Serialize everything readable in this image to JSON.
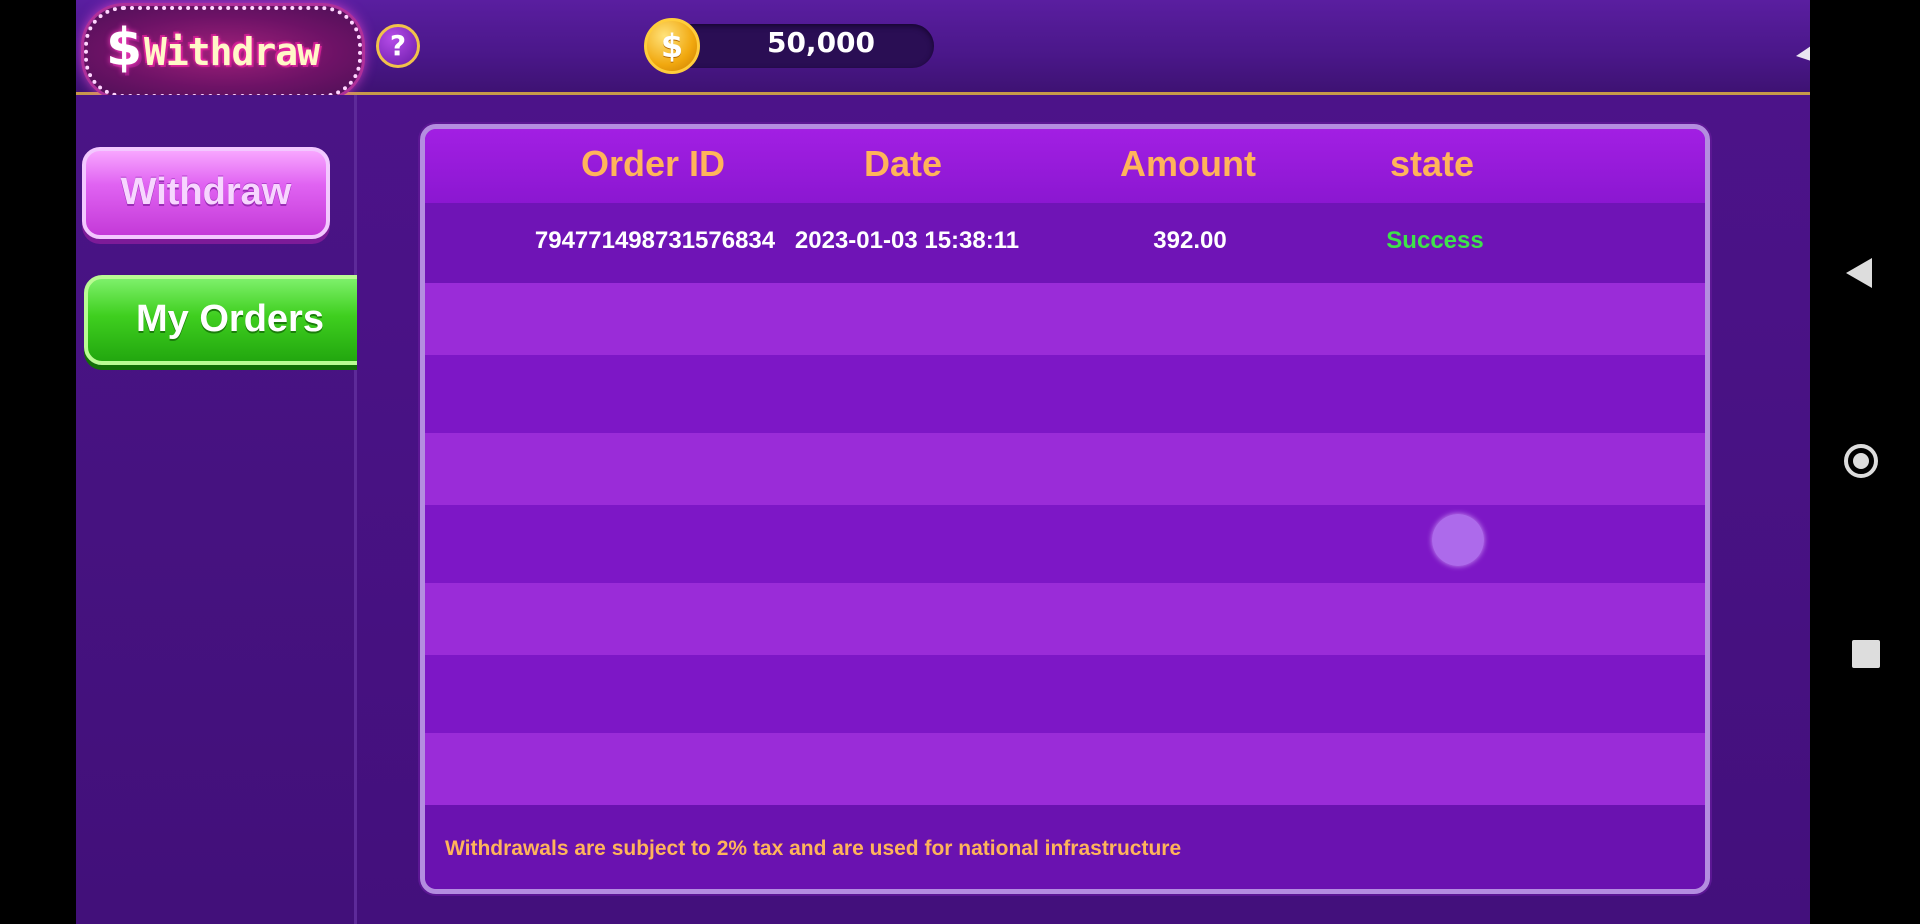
{
  "header": {
    "title_dollar": "$",
    "title": "Withdraw",
    "help_symbol": "?",
    "coin_symbol": "$",
    "balance": "50,000"
  },
  "sidebar": {
    "items": [
      {
        "label": "Withdraw",
        "selected": false
      },
      {
        "label": "My Orders",
        "selected": true
      }
    ]
  },
  "orders": {
    "columns": [
      "Order ID",
      "Date",
      "Amount",
      "state"
    ],
    "rows": [
      {
        "order_id": "794771498731576834",
        "date": "2023-01-03 15:38:11",
        "amount": "392.00",
        "state": "Success"
      }
    ],
    "note": "Withdrawals are subject to 2% tax and are used for national infrastructure"
  },
  "colors": {
    "header_text": "#ffb45a",
    "success": "#3ee24a",
    "background": "#7e1bc4"
  }
}
